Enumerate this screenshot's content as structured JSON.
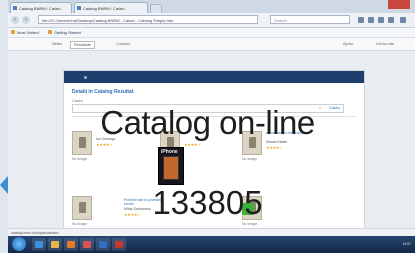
{
  "browser": {
    "tabs": [
      {
        "label": "Catalog BNRM / Catalo"
      },
      {
        "label": "Catalog BNRM / Catalo"
      }
    ],
    "url": "file:///C:/Users/Irina/Desktop/Catalog BNRM - Catalo - Catalog Simplu.htm",
    "search_placeholder": "Search",
    "bookmarks": [
      "Most Visited",
      "Getting Started"
    ]
  },
  "site": {
    "selector_value": "Resultate",
    "selector_prefix": "Selec",
    "links": [
      "Contact",
      "Ajutor",
      "Limba site"
    ]
  },
  "panel": {
    "title": "Detalii in Catalog Rezultat",
    "sub": "Cauta",
    "go_label": "Cauta",
    "clear_label": "x"
  },
  "books": [
    {
      "cover_text": "No Image",
      "title": "",
      "author": "Ion Creanga",
      "stars": "★★★★☆"
    },
    {
      "cover_text": "No Image",
      "title": "",
      "author": "",
      "stars": "★★★★☆"
    },
    {
      "cover_text": "No Image",
      "title": "Introducere in tehnica...",
      "author": "Mircea Eliade",
      "stars": "★★★★☆"
    },
    {
      "cover_text": "No Image",
      "title": "",
      "author": "",
      "stars": ""
    },
    {
      "cover_text": "No Image",
      "title": "Povesti mari si povestiri scurte...",
      "author": "Mihai Sadoveanu",
      "stars": "★★★★☆"
    },
    {
      "cover_text": "No Image",
      "title": "",
      "author": "",
      "stars": ""
    }
  ],
  "phone_cover": {
    "brand": "iPhone"
  },
  "statusbar": {
    "text": "catalog.bnrm.md/opac/cautare..."
  },
  "taskbar": {
    "clock": "14:07"
  },
  "overlay": {
    "title": "Catalog on-line",
    "number": "133805"
  }
}
